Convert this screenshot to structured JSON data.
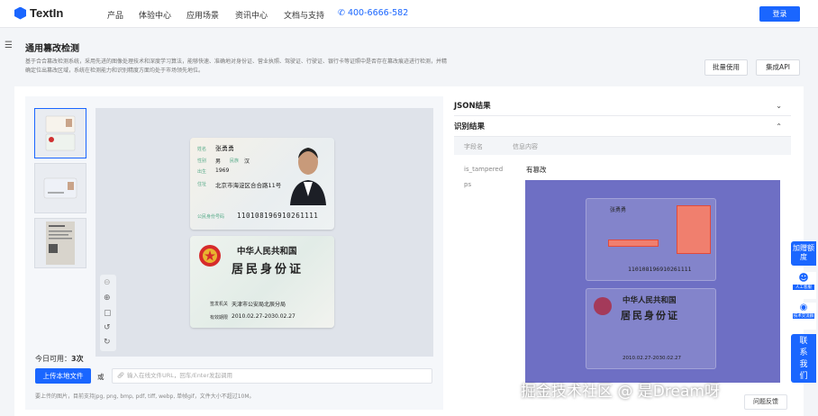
{
  "nav": {
    "logo": "TextIn",
    "items": [
      "产品",
      "体验中心",
      "应用场景",
      "资讯中心",
      "文档与支持"
    ],
    "phone": "400-6666-582",
    "login": "登录"
  },
  "header": {
    "title": "通用篡改检测",
    "desc": "基于合合篡改检测系统，采用先进的图像处理技术和深度学习算法，能够快速、准确地对身份证、营业执照、驾驶证、行驶证、银行卡等证照中是否存在篡改痕迹进行检测，并精确定位出篡改区域，系统在检测能力和识别精度方面均处于市场领先地位。",
    "batch": "批量使用",
    "api": "集成API"
  },
  "left": {
    "quota_label": "今日可用：",
    "quota_value": "3次",
    "upload": "上传本地文件",
    "or": "或",
    "url_placeholder": "输入在线文件URL，回车/Enter发起调用",
    "hint": "要上传的图片，目前支持jpg, png, bmp, pdf, tiff, webp, 单帧gif，文件大小不超过10M。"
  },
  "card": {
    "name_lbl": "姓名",
    "name": "张勇勇",
    "sex_lbl": "性别",
    "sex": "男",
    "eth_lbl": "民族",
    "eth": "汉",
    "birth_lbl": "出生",
    "year": "1969",
    "addr_lbl": "住址",
    "addr": "北京市海淀区合合路11号",
    "id_lbl": "公民身份号码",
    "id": "110108196910261111",
    "back_title": "中华人民共和国",
    "back_sub": "居民身份证",
    "auth_lbl": "签发机关",
    "auth": "天津市公安局北辰分局",
    "valid_lbl": "有效期限",
    "valid": "2010.02.27-2030.02.27"
  },
  "right": {
    "json_title": "JSON结果",
    "result_title": "识别结果",
    "col1": "字段名",
    "col2": "信息内容",
    "rows": [
      {
        "k": "is_tampered",
        "v": "有篡改"
      },
      {
        "k": "ps",
        "v": ""
      }
    ]
  },
  "side": {
    "quota": "加赠额度",
    "service": "人工客服",
    "tech": "技术交流群",
    "contact": "联系我们",
    "feedback": "问题反馈"
  },
  "watermark": "掘金技术社区 @ 是Dream呀",
  "colors": {
    "accent": "#1a66ff",
    "overlay": "#6e6fc4"
  }
}
